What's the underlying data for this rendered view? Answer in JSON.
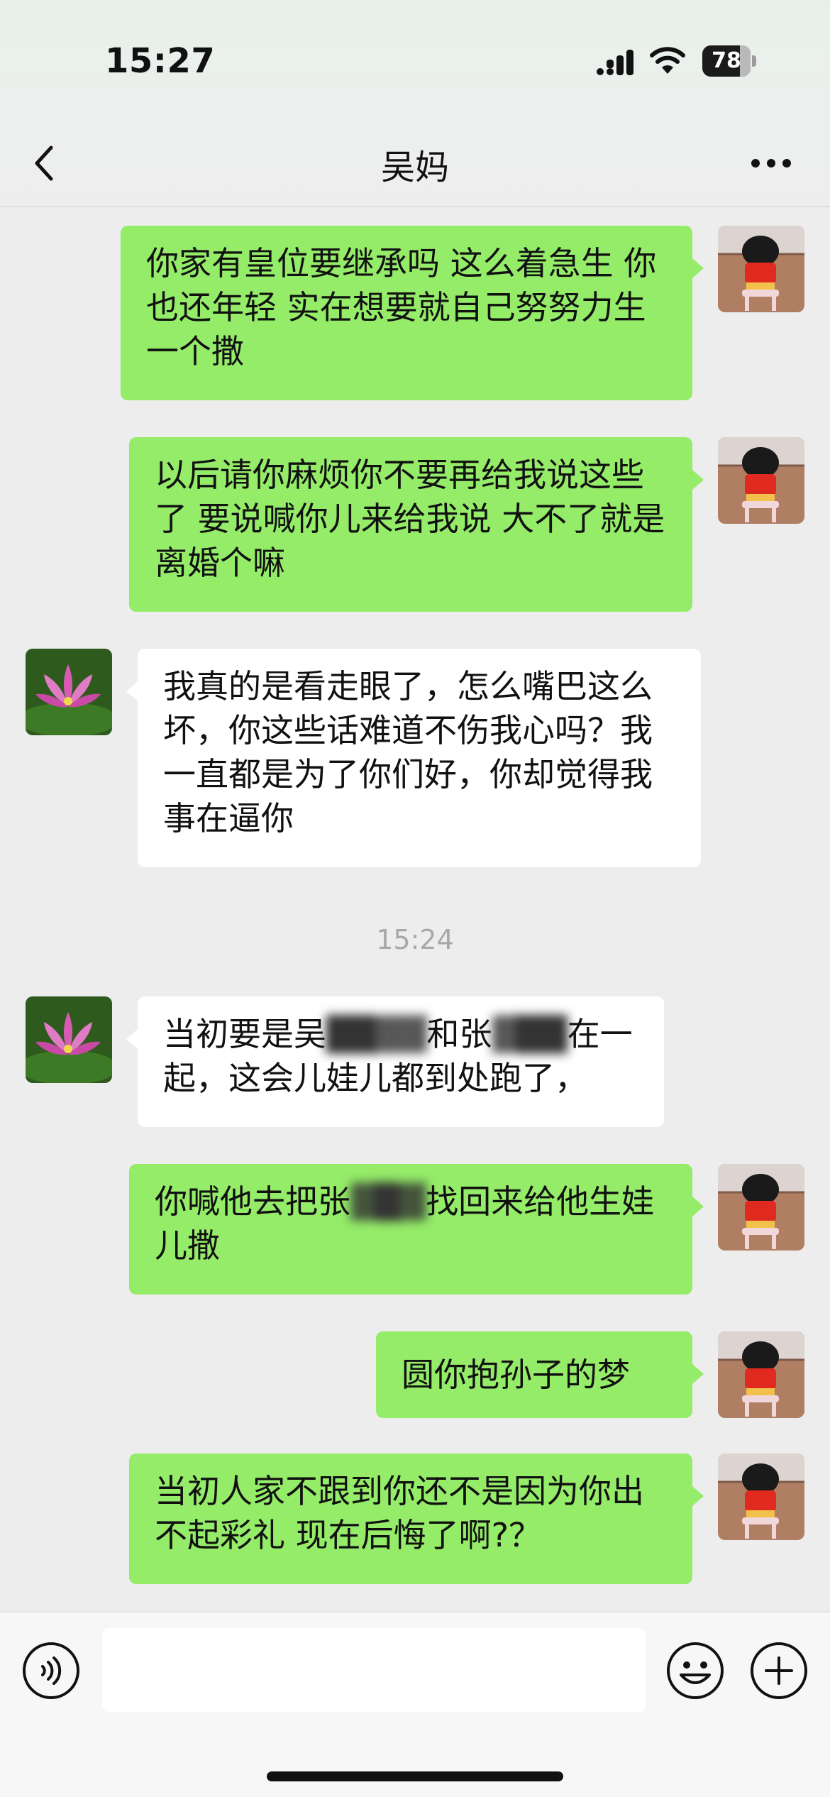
{
  "status_bar": {
    "time": "15:27",
    "battery_level": "78",
    "battery_fraction": 0.78
  },
  "header": {
    "title": "吴妈"
  },
  "messages": [
    {
      "side": "right",
      "text": "你家有皇位要继承吗 这么着急生 你也还年轻 实在想要就自己努努力生一个撒"
    },
    {
      "side": "right",
      "text": "以后请你麻烦你不要再给我说这些了 要说喊你儿来给我说 大不了就是离婚个嘛"
    },
    {
      "side": "left",
      "text": "我真的是看走眼了，怎么嘴巴这么坏，你这些话难道不伤我心吗？我一直都是为了你们好，你却觉得我事在逼你"
    },
    {
      "type": "timestamp",
      "text": "15:24"
    },
    {
      "side": "left",
      "parts": [
        "当初要是吴",
        "和张",
        "在一起，这会儿娃儿都到处跑了，"
      ]
    },
    {
      "side": "right",
      "parts": [
        "你喊他去把张",
        "找回来给他生娃儿撒"
      ]
    },
    {
      "side": "right",
      "text": "圆你抱孙子的梦"
    },
    {
      "side": "right",
      "text": "当初人家不跟到你还不是因为你出不起彩礼 现在后悔了啊?？"
    }
  ],
  "input": {
    "placeholder": ""
  },
  "colors": {
    "sent_bubble": "#95ec69",
    "received_bubble": "#ffffff",
    "background": "#ededed"
  },
  "icons": {
    "back": "chevron-left-icon",
    "more": "ellipsis-icon",
    "voice": "voice-icon",
    "emoji": "emoji-icon",
    "plus": "plus-icon",
    "self_avatar": "cartoon-child-avatar",
    "contact_avatar": "lotus-flower-avatar"
  }
}
